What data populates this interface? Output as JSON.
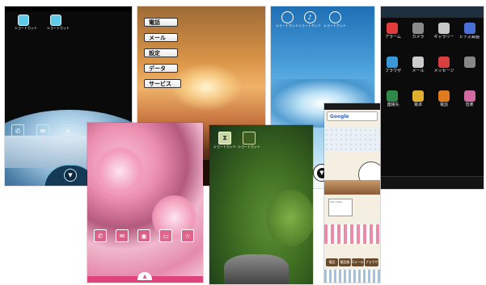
{
  "screen1": {
    "shortcuts": [
      {
        "label": "ショートカット",
        "icon": "chat-bubble-icon"
      },
      {
        "label": "ショートカット",
        "icon": "chat-bubble-icon"
      }
    ],
    "dock": [
      "phone-icon",
      "mail-icon",
      "settings-icon",
      "app-icon",
      "app-icon"
    ]
  },
  "screen2": {
    "menu": [
      "電話",
      "メール",
      "設定",
      "データ",
      "サービス"
    ]
  },
  "screen3": {
    "shortcuts": [
      {
        "label": "ショートカット"
      },
      {
        "label": "ショートカット"
      },
      {
        "label": "ショートカット"
      }
    ]
  },
  "screen4": {
    "apps": [
      {
        "label": "アラーム",
        "color": "#e23b3b"
      },
      {
        "label": "カメラ",
        "color": "#8a8a8a"
      },
      {
        "label": "ギャラリー",
        "color": "#c8c8c8"
      },
      {
        "label": "ビデオ録画",
        "color": "#4a6fd6"
      },
      {
        "label": "ブラウザ",
        "color": "#3a9ad9"
      },
      {
        "label": "メール",
        "color": "#cccccc"
      },
      {
        "label": "メッセージ",
        "color": "#d84040"
      },
      {
        "label": "",
        "color": "#888888"
      },
      {
        "label": "連絡先",
        "color": "#2f8a4a"
      },
      {
        "label": "電卓",
        "color": "#e0b030"
      },
      {
        "label": "電話",
        "color": "#e07a1f"
      },
      {
        "label": "音楽",
        "color": "#d06aa0"
      }
    ]
  },
  "screen5": {
    "dock": [
      "phone-icon",
      "mail-icon",
      "camera-icon",
      "folder-icon",
      "star-icon"
    ]
  },
  "screen6": {
    "shortcuts": [
      {
        "label": "ショートカット"
      },
      {
        "label": "ショートカット"
      }
    ]
  },
  "screen7": {
    "search_logo": "Google",
    "clock_label": "",
    "memo_label": "link colors",
    "dock": [
      "電話",
      "電話帳",
      "Eメール",
      "ブラウザ"
    ]
  }
}
